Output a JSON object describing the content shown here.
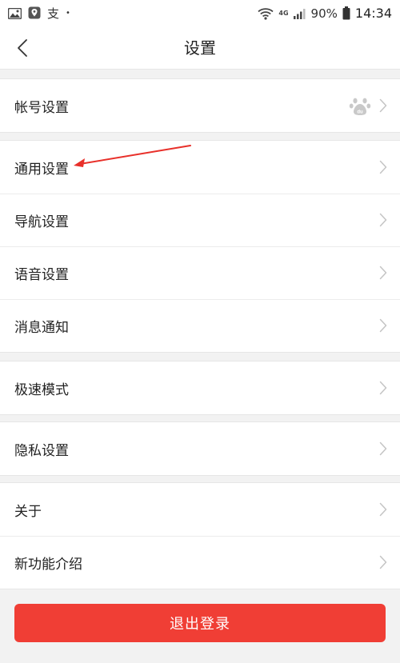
{
  "status_bar": {
    "left_text": "支",
    "dot": "•",
    "network": "4G",
    "battery": "90%",
    "time": "14:34",
    "icons": [
      "gallery-icon",
      "location-icon",
      "wifi-icon",
      "signal-icon",
      "battery-icon"
    ]
  },
  "header": {
    "title": "设置",
    "back_icon": "chevron-left-icon"
  },
  "groups": [
    {
      "items": [
        {
          "label": "帐号设置",
          "avatar": "baidu-paw-icon"
        }
      ]
    },
    {
      "items": [
        {
          "label": "通用设置"
        },
        {
          "label": "导航设置"
        },
        {
          "label": "语音设置"
        },
        {
          "label": "消息通知"
        }
      ]
    },
    {
      "items": [
        {
          "label": "极速模式"
        }
      ]
    },
    {
      "items": [
        {
          "label": "隐私设置"
        }
      ]
    },
    {
      "items": [
        {
          "label": "关于"
        },
        {
          "label": "新功能介绍"
        }
      ]
    }
  ],
  "logout_label": "退出登录",
  "colors": {
    "accent": "#f03e35",
    "background": "#f2f2f2",
    "row": "#ffffff",
    "annotation": "#e8302a"
  }
}
